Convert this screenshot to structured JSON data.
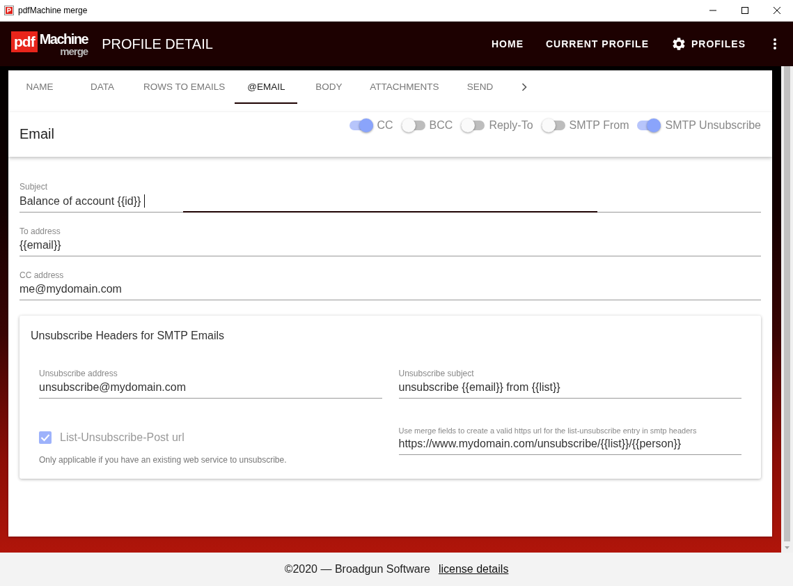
{
  "window": {
    "title": "pdfMachine merge"
  },
  "app_bar": {
    "logo": {
      "badge": "pdf",
      "name": "Machine",
      "sub": "merge"
    },
    "title": "PROFILE DETAIL",
    "nav": [
      {
        "label": "HOME",
        "kind": "text"
      },
      {
        "label": "CURRENT PROFILE",
        "kind": "text"
      },
      {
        "label": "PROFILES",
        "kind": "gear"
      }
    ]
  },
  "tabs": [
    {
      "label": "NAME",
      "selected": false
    },
    {
      "label": "DATA",
      "selected": false
    },
    {
      "label": "ROWS TO EMAILS",
      "selected": false
    },
    {
      "label": "@EMAIL",
      "selected": true
    },
    {
      "label": "BODY",
      "selected": false
    },
    {
      "label": "ATTACHMENTS",
      "selected": false
    },
    {
      "label": "SEND",
      "selected": false
    }
  ],
  "email_section": {
    "title": "Email",
    "toggles": [
      {
        "label": "CC",
        "on": true
      },
      {
        "label": "BCC",
        "on": false
      },
      {
        "label": "Reply-To",
        "on": false
      },
      {
        "label": "SMTP From",
        "on": false
      },
      {
        "label": "SMTP Unsubscribe",
        "on": true
      }
    ]
  },
  "fields": [
    {
      "label": "Subject",
      "value": "Balance of account {{id}}",
      "focused": true
    },
    {
      "label": "To address",
      "value": "{{email}}",
      "focused": false
    },
    {
      "label": "CC address",
      "value": "me@mydomain.com",
      "focused": false
    }
  ],
  "unsubscribe_card": {
    "title": "Unsubscribe Headers for SMTP Emails",
    "address": {
      "label": "Unsubscribe address",
      "value": "unsubscribe@mydomain.com"
    },
    "subject": {
      "label": "Unsubscribe subject",
      "value": "unsubscribe {{email}} from {{list}}"
    },
    "post_checkbox": {
      "label": "List-Unsubscribe-Post url",
      "checked": true,
      "disabled": true
    },
    "helper": "Only applicable if you have an existing web service to unsubscribe.",
    "url": {
      "label": "Use merge fields to create a valid https url for the list-unsubscribe entry in smtp headers",
      "value": "https://www.mydomain.com/unsubscribe/{{list}}/{{person}}"
    }
  },
  "footer": {
    "text": "©2020 — Broadgun Software",
    "link": "license details"
  }
}
